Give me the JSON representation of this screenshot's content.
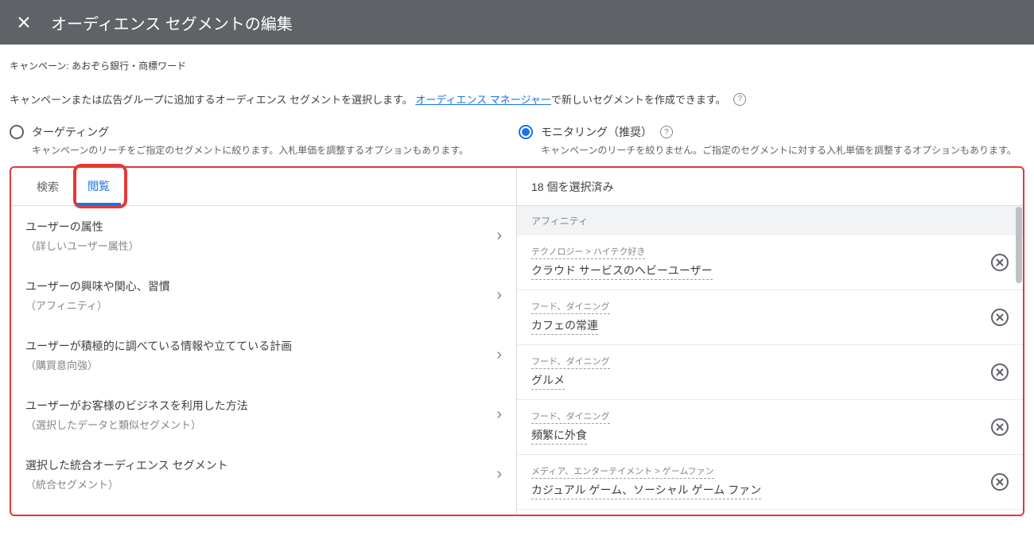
{
  "header": {
    "title": "オーディエンス セグメントの編集"
  },
  "campaign": {
    "label": "キャンペーン:",
    "name": "あおぞら銀行・商標ワード"
  },
  "description": {
    "prefix": "キャンペーンまたは広告グループに追加するオーディエンス セグメントを選択します。",
    "link": "オーディエンス マネージャー",
    "suffix": "で新しいセグメントを作成できます。"
  },
  "radios": {
    "targeting": {
      "title": "ターゲティング",
      "sub": "キャンペーンのリーチをご指定のセグメントに絞ります。入札単価を調整するオプションもあります。"
    },
    "monitoring": {
      "title": "モニタリング（推奨）",
      "sub": "キャンペーンのリーチを絞りません。ご指定のセグメントに対する入札単価を調整するオプションもあります。"
    }
  },
  "tabs": {
    "search": "検索",
    "browse": "閲覧"
  },
  "browse_items": [
    {
      "title": "ユーザーの属性",
      "sub": "（詳しいユーザー属性）"
    },
    {
      "title": "ユーザーの興味や関心、習慣",
      "sub": "（アフィニティ）"
    },
    {
      "title": "ユーザーが積極的に調べている情報や立てている計画",
      "sub": "（購買意向強）"
    },
    {
      "title": "ユーザーがお客様のビジネスを利用した方法",
      "sub": "（選択したデータと類似セグメント）"
    },
    {
      "title": "選択した統合オーディエンス セグメント",
      "sub": "（統合セグメント）"
    }
  ],
  "selected": {
    "count_label": "18 個を選択済み",
    "group": "アフィニティ",
    "items": [
      {
        "crumb": "テクノロジー > ハイテク好き",
        "title": "クラウド サービスのヘビーユーザー"
      },
      {
        "crumb": "フード、ダイニング",
        "title": "カフェの常連"
      },
      {
        "crumb": "フード、ダイニング",
        "title": "グルメ"
      },
      {
        "crumb": "フード、ダイニング",
        "title": "頻繁に外食"
      },
      {
        "crumb": "メディア、エンターテイメント > ゲームファン",
        "title": "カジュアル ゲーム、ソーシャル ゲーム ファン"
      }
    ]
  }
}
